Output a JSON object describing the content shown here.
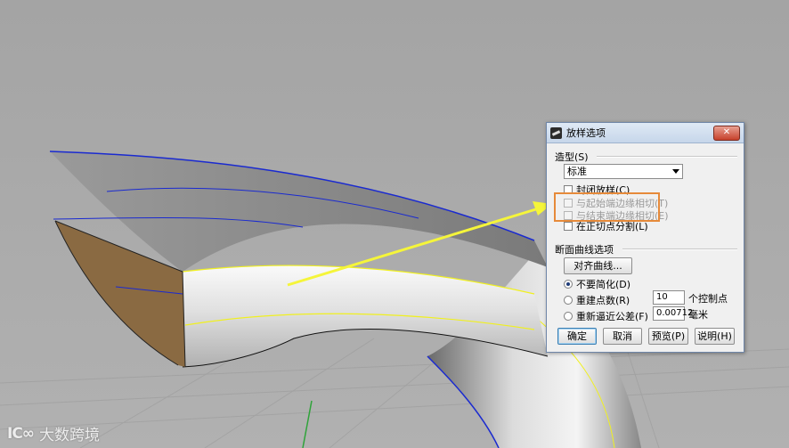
{
  "dialog": {
    "title": "放样选项",
    "close_label": "✕",
    "style_section": {
      "label": "造型(S)",
      "selected": "标准",
      "options": [
        {
          "label": "封闭放样(C)",
          "checked": false,
          "enabled": true
        },
        {
          "label": "与起始端边缘相切(T)",
          "checked": false,
          "enabled": false
        },
        {
          "label": "与结束端边缘相切(E)",
          "checked": false,
          "enabled": false
        },
        {
          "label": "在正切点分割(L)",
          "checked": false,
          "enabled": true
        }
      ]
    },
    "cross_section": {
      "label": "断面曲线选项",
      "align_button": "对齐曲线...",
      "radio_no_simplify": "不要简化(D)",
      "radio_rebuild_points": "重建点数(R)",
      "rebuild_points_value": "10",
      "rebuild_points_unit": "个控制点",
      "radio_refit_tolerance": "重新逼近公差(F)",
      "tolerance_value": "0.00712",
      "tolerance_unit": "毫米",
      "selected_radio": "不要简化(D)"
    },
    "buttons": {
      "ok": "确定",
      "cancel": "取消",
      "preview": "预览(P)",
      "help": "说明(H)"
    }
  },
  "watermark": {
    "logo": "IC∞",
    "text": "大数跨境"
  },
  "colors": {
    "viewport_bg": "#a9a9a9",
    "accent_arrow": "#f5f53a",
    "highlight_box": "#e68a3a",
    "curve_blue": "#1a2ad0",
    "curve_yellow": "#f0f020"
  }
}
